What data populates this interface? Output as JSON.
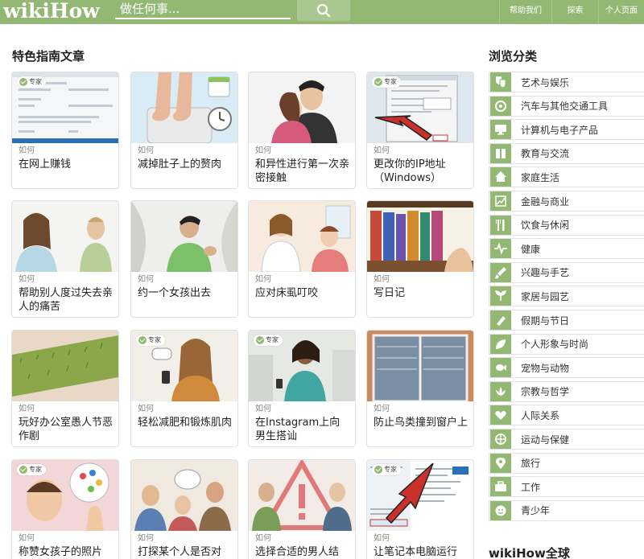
{
  "header": {
    "logo_wiki": "wiki",
    "logo_how": "How",
    "search_placeholder": "做任何事...",
    "nav": [
      "帮助我们",
      "探索",
      "个人页面"
    ]
  },
  "featured": {
    "title": "特色指南文章",
    "how_label": "如何",
    "badge_label": "专家",
    "cards": [
      {
        "title": "在网上赚钱",
        "badge": true,
        "icon": "web-form-screenshot"
      },
      {
        "title": "减掉肚子上的赘肉",
        "badge": false,
        "icon": "scale-feet"
      },
      {
        "title": "和异性进行第一次亲密接触",
        "badge": false,
        "icon": "couple-hug"
      },
      {
        "title": "更改你的IP地址（Windows）",
        "badge": true,
        "icon": "windows-dialog-arrow"
      },
      {
        "title": "帮助别人度过失去亲人的痛苦",
        "badge": false,
        "icon": "grieving-people"
      },
      {
        "title": "约一个女孩出去",
        "badge": false,
        "icon": "boy-asking"
      },
      {
        "title": "应对床虱叮咬",
        "badge": false,
        "icon": "doctor-patient"
      },
      {
        "title": "写日记",
        "badge": false,
        "icon": "journals-shelf"
      },
      {
        "title": "玩好办公室愚人节恶作剧",
        "badge": false,
        "icon": "grass-keyboard"
      },
      {
        "title": "轻松减肥和锻炼肌肉",
        "badge": true,
        "icon": "woman-phone"
      },
      {
        "title": "在Instagram上向男生搭讪",
        "badge": true,
        "icon": "woman-city"
      },
      {
        "title": "防止鸟类撞到窗户上",
        "badge": false,
        "icon": "window-glass"
      },
      {
        "title": "称赞女孩子的照片",
        "badge": true,
        "icon": "ok-hand-palette"
      },
      {
        "title": "打探某个人是否对",
        "badge": false,
        "icon": "group-talk"
      },
      {
        "title": "选择合适的男人结",
        "badge": false,
        "icon": "warning-sign"
      },
      {
        "title": "让笔记本电脑运行",
        "badge": true,
        "icon": "system-dialog-arrow"
      }
    ]
  },
  "sidebar": {
    "title": "浏览分类",
    "categories": [
      {
        "label": "艺术与娱乐",
        "icon": "theater-masks-icon"
      },
      {
        "label": "汽车与其他交通工具",
        "icon": "car-icon"
      },
      {
        "label": "计算机与电子产品",
        "icon": "monitor-icon"
      },
      {
        "label": "教育与交流",
        "icon": "book-icon"
      },
      {
        "label": "家庭生活",
        "icon": "house-icon"
      },
      {
        "label": "金融与商业",
        "icon": "chart-icon"
      },
      {
        "label": "饮食与休闲",
        "icon": "fork-knife-icon"
      },
      {
        "label": "健康",
        "icon": "heartbeat-icon"
      },
      {
        "label": "兴趣与手艺",
        "icon": "brush-icon"
      },
      {
        "label": "家居与园艺",
        "icon": "plant-icon"
      },
      {
        "label": "假期与节日",
        "icon": "ornament-icon"
      },
      {
        "label": "个人形象与时尚",
        "icon": "leaf-icon"
      },
      {
        "label": "宠物与动物",
        "icon": "fish-icon"
      },
      {
        "label": "宗教与哲学",
        "icon": "lotus-icon"
      },
      {
        "label": "人际关系",
        "icon": "heart-icon"
      },
      {
        "label": "运动与保健",
        "icon": "ball-icon"
      },
      {
        "label": "旅行",
        "icon": "map-pin-icon"
      },
      {
        "label": "工作",
        "icon": "briefcase-icon"
      },
      {
        "label": "青少年",
        "icon": "face-icon"
      }
    ]
  },
  "global": {
    "title": "wikiHow全球"
  }
}
